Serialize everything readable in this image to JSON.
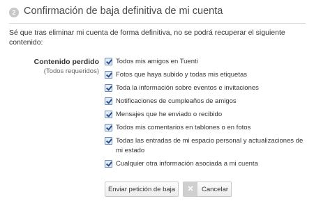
{
  "header": {
    "step_number": "2",
    "title": "Confirmación de baja definitiva de mi cuenta"
  },
  "intro": "Sé que tras eliminar mi cuenta de forma definitiva, no se podrá recuperar el siguiente contenido:",
  "lost_content": {
    "label": "Contenido perdido",
    "sublabel": "(Todos requeridos)",
    "items": [
      {
        "label": "Todos mis amigos en Tuenti",
        "checked": true
      },
      {
        "label": "Fotos que haya subido y todas mis etiquetas",
        "checked": true
      },
      {
        "label": "Toda la información sobre eventos e invitaciones",
        "checked": true
      },
      {
        "label": "Notificaciones de cumpleaños de amigos",
        "checked": true
      },
      {
        "label": "Mensajes que he enviado o recibido",
        "checked": true
      },
      {
        "label": "Todos mis comentarios en tablones o en fotos",
        "checked": true
      },
      {
        "label": "Todas las entradas de mi espacio personal y actualizaciones de mi estado",
        "checked": true
      },
      {
        "label": "Cualquier otra información asociada a mi cuenta",
        "checked": true
      }
    ]
  },
  "actions": {
    "submit_label": "Enviar petición de baja",
    "cancel_label": "Cancelar",
    "cancel_icon": "close-icon"
  }
}
